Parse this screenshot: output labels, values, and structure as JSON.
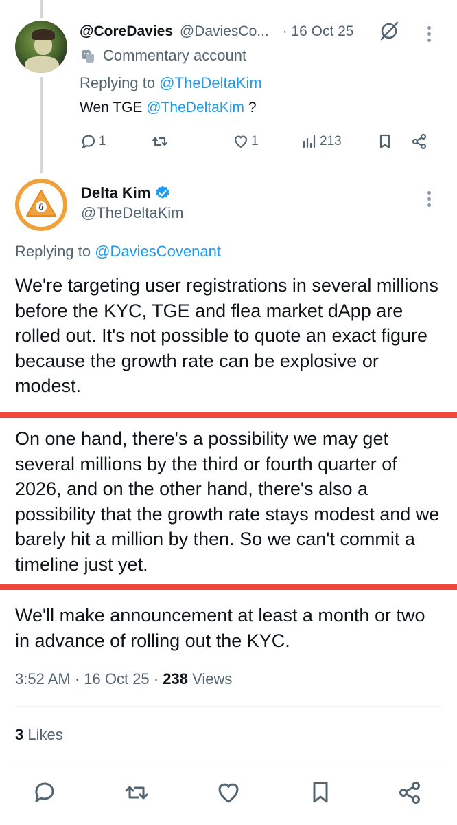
{
  "reply_tweet": {
    "display_name": "@CoreDavies",
    "handle": "@DaviesCo...",
    "time": "· 16 Oct 25",
    "badge_label": "Commentary account",
    "replying_prefix": "Replying to",
    "replying_to": "@TheDeltaKim",
    "text_prefix": "Wen TGE",
    "text_mention": "@TheDeltaKim",
    "text_suffix": "?",
    "actions": {
      "replies": "1",
      "retweets": "",
      "likes": "1",
      "views": "213"
    }
  },
  "main_tweet": {
    "display_name": "Delta Kim",
    "handle": "@TheDeltaKim",
    "replying_prefix": "Replying to",
    "replying_to": "@DaviesCovenant",
    "paragraphs": [
      "We're targeting user registrations in several millions before the KYC, TGE and flea market dApp are rolled out. It's not possible to quote an exact figure because the growth rate can be explosive or modest.",
      "On one hand, there's a possibility we may get several millions by the third or fourth quarter of 2026, and on the other hand, there's also a possibility that the growth rate stays modest and we barely hit a million by then. So we can't commit a timeline just yet.",
      "We'll make announcement at least a month or two in advance of rolling out the KYC."
    ],
    "timestamp": "3:52 AM · 16 Oct 25 ·",
    "views_count": "238",
    "views_label": "Views",
    "likes_count": "3",
    "likes_label": "Likes"
  },
  "colors": {
    "link": "#1d9bf0",
    "secondary_text": "#536471",
    "highlight_line": "#f0463c",
    "verified": "#1d9bf0",
    "avatar_orange": "#f0a13c"
  },
  "icons": [
    "grok-icon",
    "more-icon",
    "masks-icon",
    "reply-icon",
    "retweet-icon",
    "like-icon",
    "views-icon",
    "bookmark-icon",
    "share-icon",
    "verified-icon"
  ]
}
